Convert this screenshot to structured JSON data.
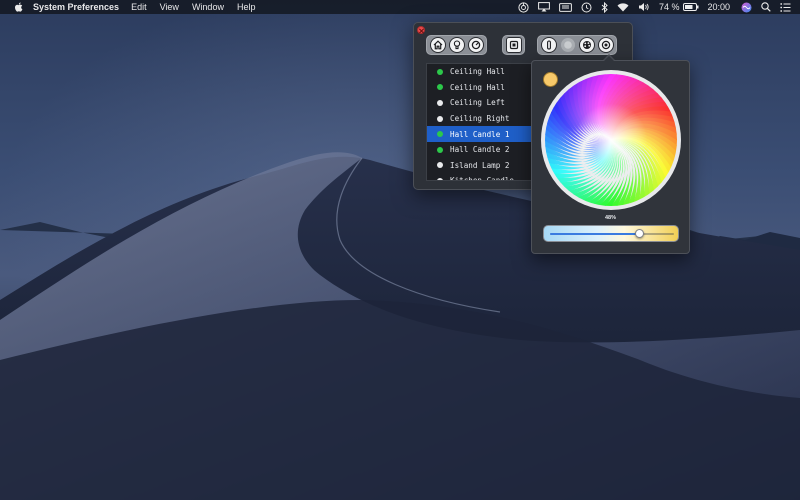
{
  "menubar": {
    "app_name": "System Preferences",
    "menus": [
      "Edit",
      "View",
      "Window",
      "Help"
    ],
    "status_icons": [
      "light-control-icon",
      "airplay-icon",
      "keyboard-icon",
      "time-machine-icon",
      "bluetooth-icon",
      "wifi-icon",
      "volume-icon"
    ],
    "battery_percent": "74 %",
    "clock": "20:00"
  },
  "popover": {
    "toolbar_left": [
      "home-icon",
      "bulb-icon",
      "power-icon"
    ],
    "toolbar_mid": [
      "scene-icon"
    ],
    "toolbar_right": [
      "device-icon",
      "toggle-icon",
      "palette-icon",
      "settings-icon"
    ],
    "lights": [
      {
        "name": "Ceiling Hall",
        "status": "on",
        "color": "#2cc84a"
      },
      {
        "name": "Ceiling Hall",
        "status": "on",
        "color": "#2cc84a"
      },
      {
        "name": "Ceiling Left",
        "status": "off",
        "color": "#e9eaec"
      },
      {
        "name": "Ceiling Right",
        "status": "off",
        "color": "#e9eaec"
      },
      {
        "name": "Hall Candle 1",
        "status": "on",
        "color": "#2cc84a",
        "selected": true
      },
      {
        "name": "Hall Candle 2",
        "status": "on",
        "color": "#2cc84a"
      },
      {
        "name": "Island Lamp 2",
        "status": "off",
        "color": "#e9eaec"
      },
      {
        "name": "Kitchen Candle",
        "status": "off",
        "color": "#e9eaec"
      }
    ]
  },
  "color_panel": {
    "selected_color": "#f7c96a",
    "brightness_label": "48%",
    "brightness": 0.72
  }
}
